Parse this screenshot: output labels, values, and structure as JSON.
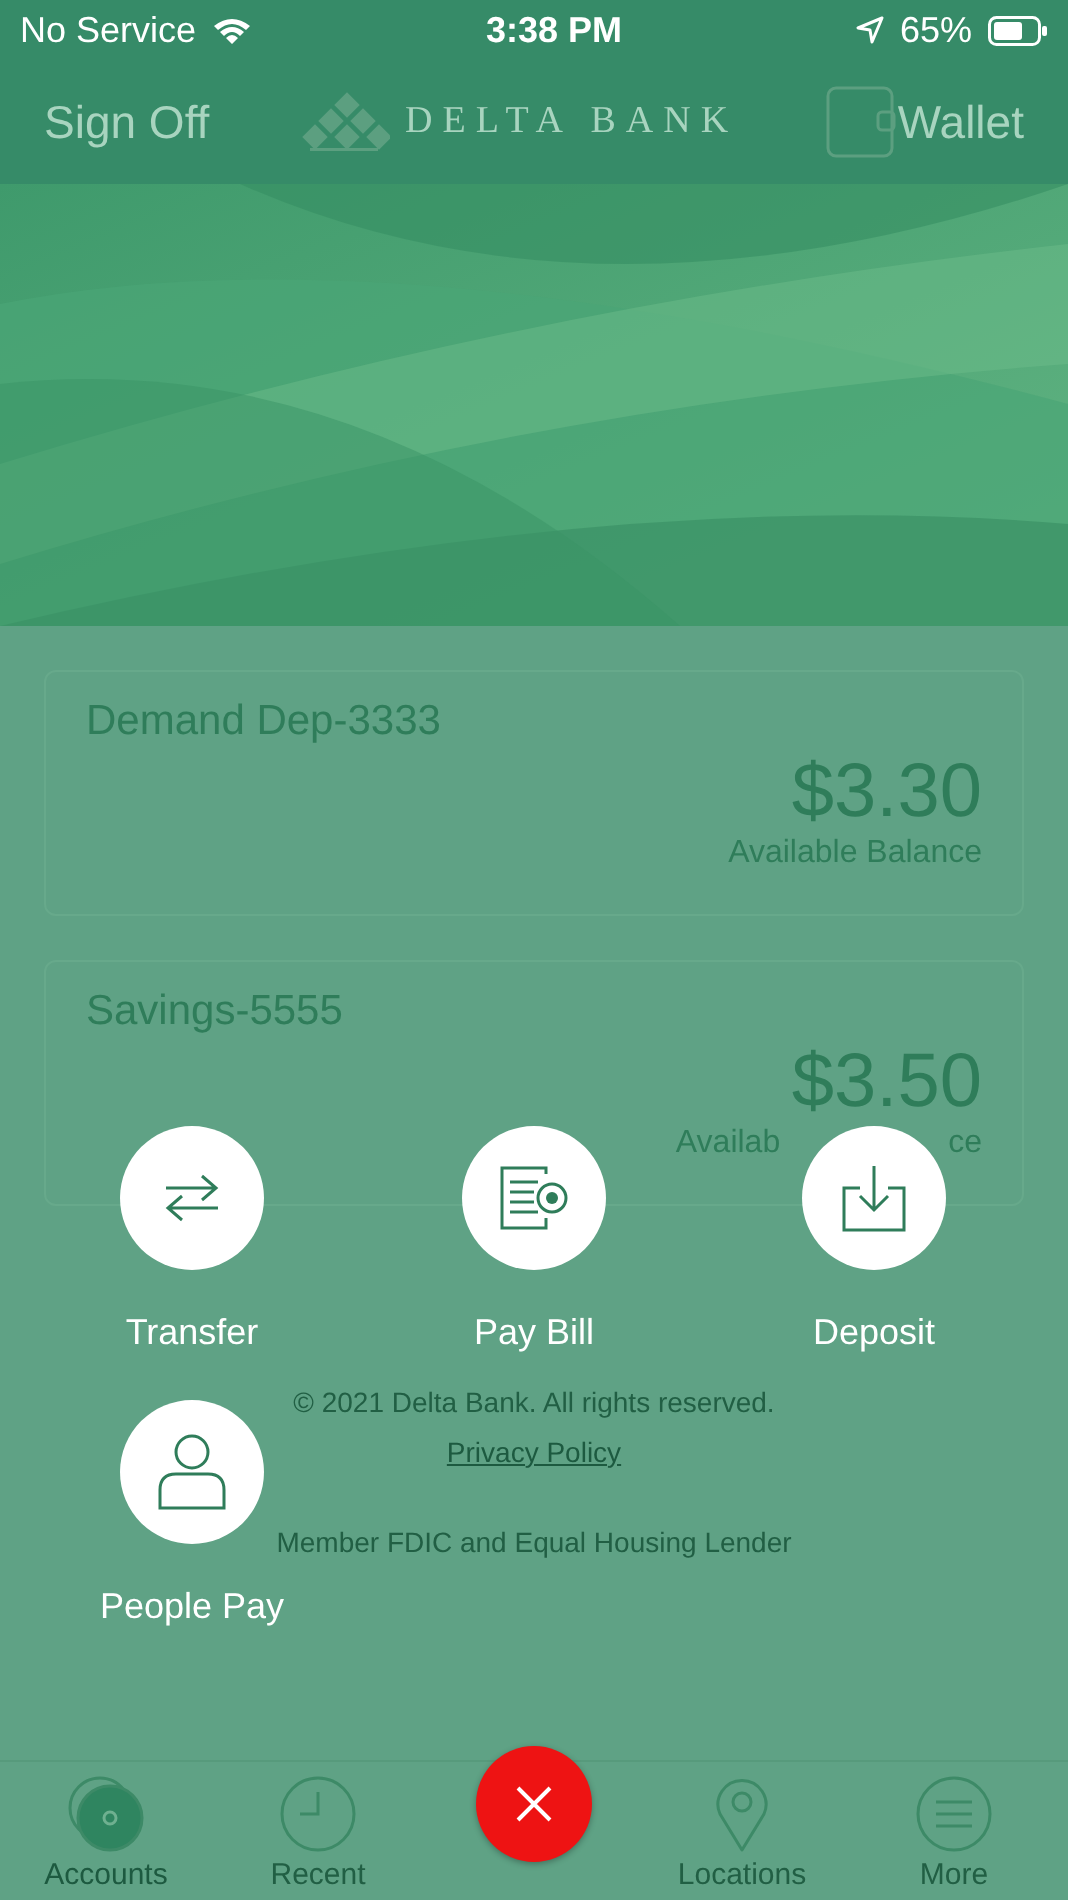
{
  "status_bar": {
    "carrier": "No Service",
    "time": "3:38 PM",
    "battery": "65%"
  },
  "header": {
    "left_button": "Sign Off",
    "logo": "DELTA BANK",
    "right_button": "Wallet"
  },
  "accounts": [
    {
      "name": "Demand Dep-3333",
      "balance": "$3.30",
      "balance_label": "Available Balance"
    },
    {
      "name": "Savings-5555",
      "balance": "$3.50",
      "balance_label_parts": [
        "Availab",
        "ce"
      ]
    }
  ],
  "footer": {
    "copyright": "© 2021 Delta Bank. All rights reserved.",
    "link": "Privacy Policy",
    "note": "Member FDIC and Equal Housing Lender"
  },
  "action_menu": [
    {
      "label": "Transfer",
      "kind": "transfer"
    },
    {
      "label": "Pay Bill",
      "kind": "bill"
    },
    {
      "label": "Deposit",
      "kind": "deposit"
    },
    {
      "label": "People Pay",
      "kind": "person"
    }
  ],
  "tab_bar": [
    {
      "label": "Accounts",
      "kind": "accounts",
      "selected": true
    },
    {
      "label": "Recent",
      "kind": "recent",
      "selected": false
    },
    {
      "kind": "close",
      "selected": false
    },
    {
      "label": "Locations",
      "kind": "locations",
      "selected": false
    },
    {
      "label": "More",
      "kind": "more",
      "selected": false
    }
  ]
}
